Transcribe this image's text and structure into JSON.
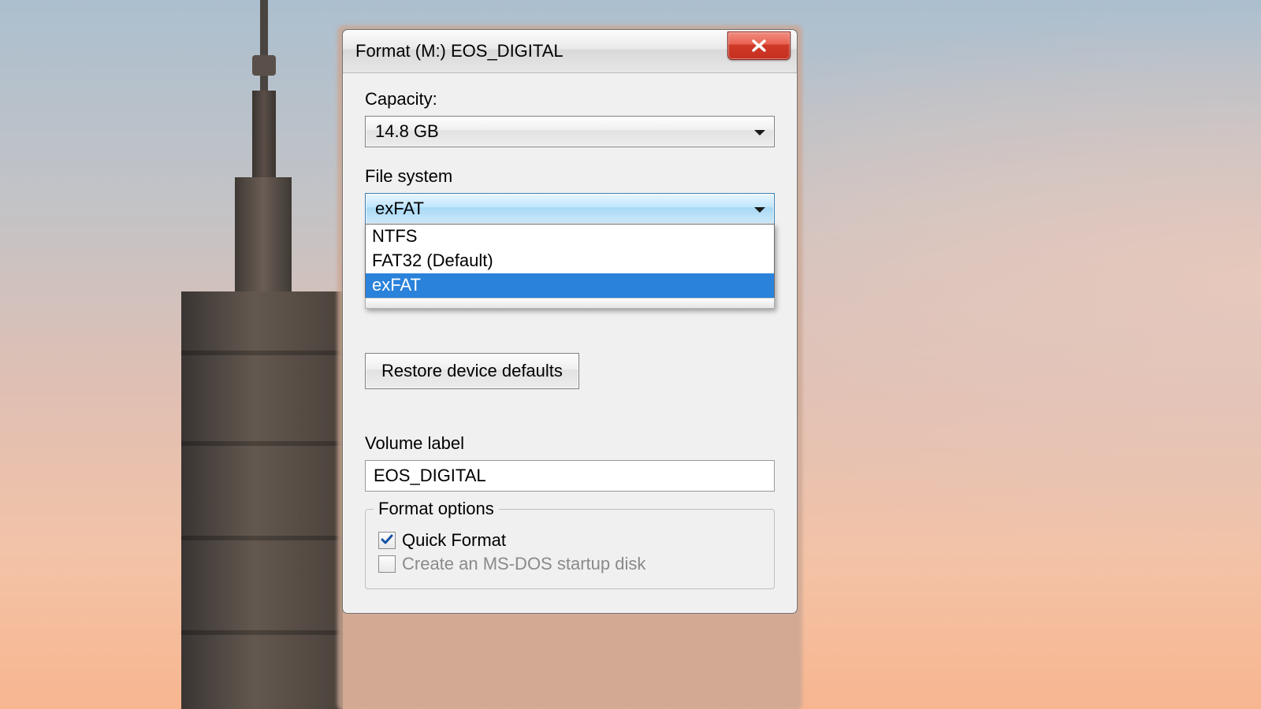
{
  "window": {
    "title": "Format (M:) EOS_DIGITAL"
  },
  "capacity": {
    "label": "Capacity:",
    "selected": "14.8 GB"
  },
  "filesystem": {
    "label": "File system",
    "selected": "exFAT",
    "options": [
      "NTFS",
      "FAT32 (Default)",
      "exFAT"
    ],
    "highlighted_index": 2
  },
  "restore_button": "Restore device defaults",
  "volume": {
    "label": "Volume label",
    "value": "EOS_DIGITAL"
  },
  "format_options": {
    "legend": "Format options",
    "quick_format": {
      "label": "Quick Format",
      "checked": true
    },
    "msdos": {
      "label": "Create an MS-DOS startup disk",
      "checked": false,
      "enabled": false
    }
  }
}
